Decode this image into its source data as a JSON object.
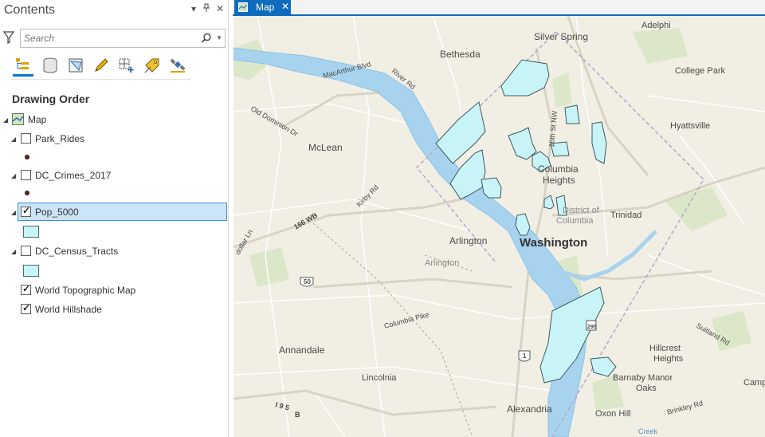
{
  "contents": {
    "title": "Contents",
    "controls": {
      "dropdown": "▾",
      "pin": "📌",
      "close": "✕"
    },
    "search": {
      "placeholder": "Search"
    },
    "toolbar": [
      "list-by-drawing-order-icon",
      "list-by-data-source-icon",
      "list-by-selection-icon",
      "list-by-editing-icon",
      "list-by-snapping-icon",
      "list-by-labeling-icon",
      "list-by-perspective-imagery-icon"
    ],
    "section_title": "Drawing Order",
    "tree": {
      "map": {
        "label": "Map"
      },
      "layers": [
        {
          "label": "Park_Rides",
          "checked": false,
          "symbol": "point"
        },
        {
          "label": "DC_Crimes_2017",
          "checked": false,
          "symbol": "point"
        },
        {
          "label": "Pop_5000",
          "checked": true,
          "symbol": "polygon",
          "selected": true
        },
        {
          "label": "DC_Census_Tracts",
          "checked": false,
          "symbol": "polygon"
        },
        {
          "label": "World Topographic Map",
          "checked": true
        },
        {
          "label": "World Hillshade",
          "checked": true
        }
      ]
    }
  },
  "map": {
    "tab_label": "Map",
    "tab_close": "✕",
    "colors": {
      "polygon_fill": "#c8f4f8",
      "river": "#a7d3ee",
      "tab": "#0f6cbd",
      "selection": "#cce4f7"
    },
    "places": {
      "silver_spring": "Silver Spring",
      "adelphi": "Adelphi",
      "bethesda": "Bethesda",
      "college_park": "College Park",
      "hyattsville": "Hyattsville",
      "mclean": "McLean",
      "columbia_heights": [
        "Columbia",
        "Heights"
      ],
      "district_of_columbia": [
        "District of",
        "Columbia"
      ],
      "trinidad": "Trinidad",
      "arlington": "Arlington",
      "arlington_county": "Arlington",
      "washington": "Washington",
      "annandale": "Annandale",
      "hillcrest_heights": [
        "Hillcrest",
        "Heights"
      ],
      "lincolnia": "Lincolnia",
      "barnaby_manor_oaks": [
        "Barnaby Manor",
        "Oaks"
      ],
      "alexandria": "Alexandria",
      "oxon_hill": "Oxon Hill",
      "camp": "Camp"
    },
    "roads": {
      "macarthur": "MacArthur Blvd",
      "river_rd": "River Rd",
      "old_dominion": "Old Dominion Dr",
      "kirby_rd": "Kirby Rd",
      "i66": "166 WB",
      "dollar_ln": "dollar Ln",
      "columbia_pike": "Columbia Pike",
      "i95": "I 9 5",
      "b": "B",
      "sixteenth_st": "16th St NW",
      "suitland": "Suitland Rd",
      "brinkley": "Brinkley Rd",
      "creek": "Creek"
    },
    "shields": {
      "us50": "50",
      "us1": "1",
      "i395": "295"
    }
  }
}
